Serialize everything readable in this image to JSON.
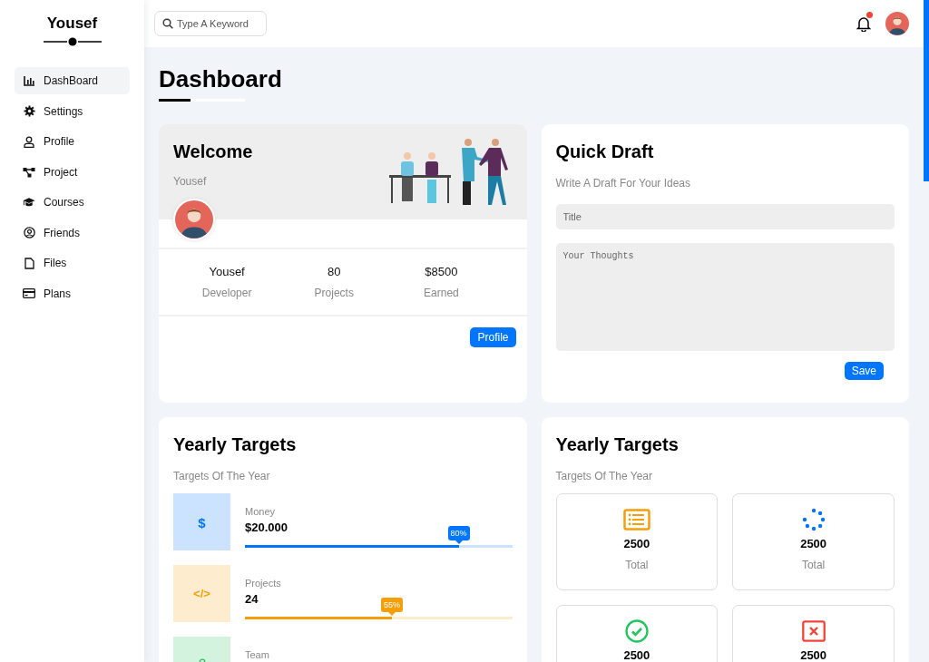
{
  "sidebar": {
    "brand": "Yousef",
    "items": [
      {
        "label": "DashBoard",
        "selected": true
      },
      {
        "label": "Settings",
        "selected": false
      },
      {
        "label": "Profile",
        "selected": false
      },
      {
        "label": "Project",
        "selected": false
      },
      {
        "label": "Courses",
        "selected": false
      },
      {
        "label": "Friends",
        "selected": false
      },
      {
        "label": "Files",
        "selected": false
      },
      {
        "label": "Plans",
        "selected": false
      }
    ]
  },
  "header": {
    "search": {
      "placeholder": "Type A Keyword"
    },
    "notifications": {
      "unread": true
    }
  },
  "page_title": "Dashboard",
  "welcome": {
    "title": "Welcome",
    "name": "Yousef",
    "stats": [
      {
        "value": "Yousef",
        "label": "Developer"
      },
      {
        "value": "80",
        "label": "Projects"
      },
      {
        "value": "$8500",
        "label": "Earned"
      }
    ],
    "button": "Profile"
  },
  "quick_draft": {
    "title": "Quick Draft",
    "subtitle": "Write A Draft For Your Ideas",
    "title_field": {
      "placeholder": "Title"
    },
    "body_field": {
      "placeholder": "Your Thoughts"
    },
    "button": "Save"
  },
  "yearly_targets": {
    "title": "Yearly Targets",
    "subtitle": "Targets Of The Year",
    "targets": [
      {
        "symbol": "$",
        "label": "Money",
        "value": "$20.000",
        "level": 0.8,
        "badge": "80%",
        "color": "#0075ff"
      },
      {
        "symbol": "</>",
        "label": "Projects",
        "value": "24",
        "level": 0.55,
        "badge": "55%",
        "color": "#f59e0b"
      },
      {
        "label": "Team",
        "color": "#22c55e"
      }
    ]
  },
  "targets_stats": {
    "title": "Yearly Targets",
    "subtitle": "Targets Of The Year",
    "tiles": [
      {
        "value": "2500",
        "label": "Total",
        "color": "#f59e0b"
      },
      {
        "value": "2500",
        "label": "Total",
        "color": "#0075ff"
      },
      {
        "value": "2500",
        "color": "#22c55e"
      },
      {
        "value": "2500",
        "color": "#f44336"
      }
    ]
  }
}
